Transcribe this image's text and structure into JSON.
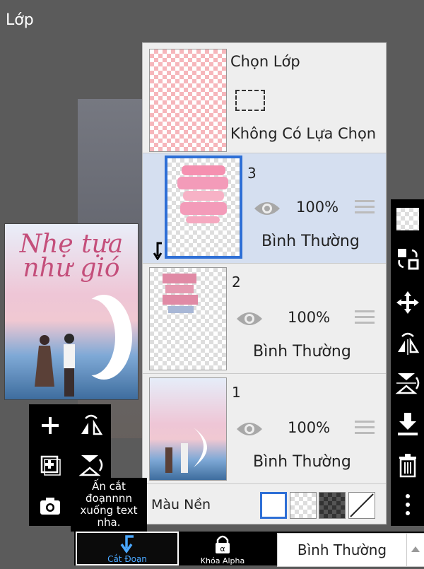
{
  "window": {
    "title": "Lớp"
  },
  "canvas": {
    "cover_title": "Nhẹ tựa như gió"
  },
  "selection": {
    "label": "Chọn Lớp",
    "status": "Không Có Lựa Chọn"
  },
  "layers": [
    {
      "number": "3",
      "opacity": "100%",
      "blend": "Bình Thường",
      "selected": true
    },
    {
      "number": "2",
      "opacity": "100%",
      "blend": "Bình Thường",
      "selected": false
    },
    {
      "number": "1",
      "opacity": "100%",
      "blend": "Bình Thường",
      "selected": false
    }
  ],
  "background": {
    "label": "Màu Nền"
  },
  "note": "Ấn cắt đoạnnnn xuống text nha.",
  "bottom": {
    "clip_label": "Cắt Đoạn",
    "alpha_label": "Khóa Alpha",
    "blend_mode": "Bình Thường"
  },
  "colors": {
    "selected_border": "#2e6fd6",
    "layer_selected_bg": "#d5dff0",
    "clip_text": "#4aa8ff"
  },
  "icons": {
    "right_toolbar": [
      "transparency-icon",
      "swap-layers-icon",
      "move-icon",
      "flip-horizontal-icon",
      "flip-vertical-icon",
      "merge-down-icon",
      "delete-icon",
      "more-icon"
    ],
    "left_toolbar": [
      "add-layer-icon",
      "flip-horizontal-icon",
      "add-image-icon",
      "flip-vertical-icon",
      "camera-icon"
    ]
  }
}
